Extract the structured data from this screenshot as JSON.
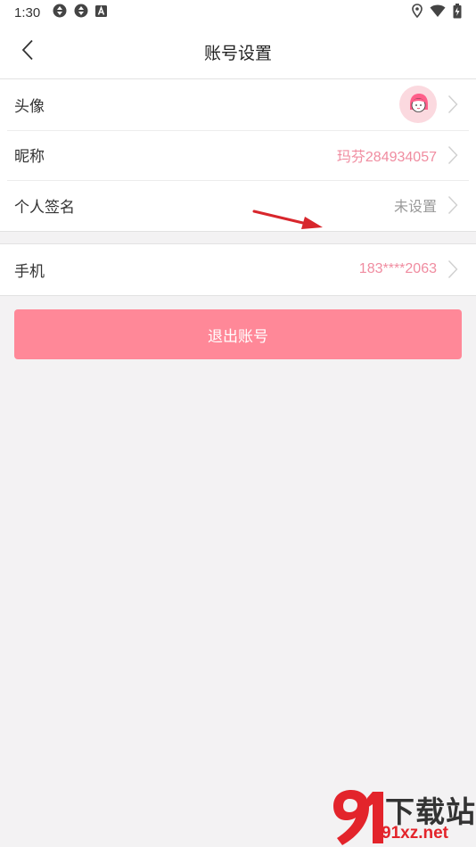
{
  "status_bar": {
    "time": "1:30",
    "left_icons": [
      "aperture-icon",
      "aperture-icon",
      "a-box-icon"
    ],
    "right_icons": [
      "location-icon",
      "wifi-icon",
      "battery-charging-icon"
    ]
  },
  "header": {
    "title": "账号设置",
    "back_icon": "chevron-left-icon"
  },
  "profile_group": {
    "rows": [
      {
        "label": "头像",
        "value": ""
      },
      {
        "label": "昵称",
        "value": "玛芬284934057"
      },
      {
        "label": "个人签名",
        "value": "未设置"
      }
    ]
  },
  "account_group": {
    "rows": [
      {
        "label": "手机",
        "value": "183****2063"
      }
    ]
  },
  "logout_button": {
    "label": "退出账号"
  },
  "watermark": {
    "text_cn": "下载站",
    "url": "91xz.net"
  },
  "colors": {
    "accent_pink": "#ff8898",
    "value_pink": "#f08ca0",
    "annotation_red": "#e3242b"
  }
}
